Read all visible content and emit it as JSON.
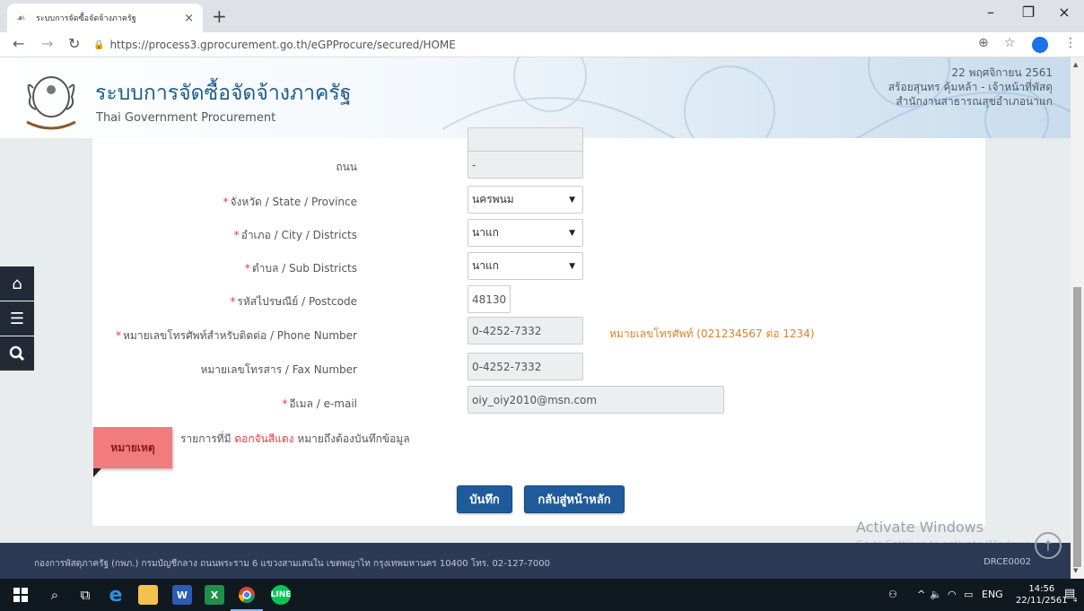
{
  "browser": {
    "tab_title": "ระบบการจัดซื้อจัดจ้างภาครัฐ",
    "tab_close": "×",
    "new_tab": "+",
    "url": "https://process3.gprocurement.go.th/eGPProcure/secured/HOME",
    "window_minimize": "–",
    "window_restore": "❐",
    "window_close": "×"
  },
  "header": {
    "system_title": "ระบบการจัดซื้อจัดจ้างภาครัฐ",
    "system_subtitle": "Thai Government Procurement",
    "date": "22 พฤศจิกายน 2561",
    "user": "สร้อยสุนทร คุ้มหล้า - เจ้าหน้าที่พัสดุ",
    "office": "สำนักงานสาธารณสุขอำเภอนาแก"
  },
  "form": {
    "street_label": "ถนน",
    "street_value": "-",
    "province_label": "จังหวัด / State / Province",
    "province_value": "นครพนม",
    "district_label": "อำเภอ / City / Districts",
    "district_value": "นาแก",
    "subdistrict_label": "ตำบล / Sub Districts",
    "subdistrict_value": "นาแก",
    "postcode_label": "รหัสไปรษณีย์ / Postcode",
    "postcode_value": "48130",
    "phone_label": "หมายเลขโทรศัพท์สำหรับติดต่อ / Phone Number",
    "phone_value": "0-4252-7332",
    "phone_hint": "หมายเลขโทรศัพท์ (021234567 ต่อ 1234)",
    "fax_label": "หมายเลขโทรสาร / Fax Number",
    "fax_value": "0-4252-7332",
    "email_label": "อีเมล / e-mail",
    "email_value": "oiy_oiy2010@msn.com",
    "required_mark": "*"
  },
  "note": {
    "tag": "หมายเหตุ",
    "text_before": "รายการที่มี ",
    "text_red": "ดอกจันสีแดง",
    "text_after": " หมายถึงต้องบันทึกข้อมูล"
  },
  "buttons": {
    "save": "บันทึก",
    "back_home": "กลับสู่หน้าหลัก"
  },
  "watermark": {
    "title": "Activate Windows",
    "subtitle": "Go to Settings to activate Windows."
  },
  "footer": {
    "address": "กองการพัสดุภาครัฐ (กพภ.) กรมบัญชีกลาง ถนนพระราม 6 แขวงสามเสนใน เขตพญาไท กรุงเทพมหานคร 10400 โทร. 02-127-7000",
    "page_code": "DRCE0002"
  },
  "taskbar": {
    "lang": "ENG",
    "time": "14:56",
    "date": "22/11/2561",
    "notification_count": "4"
  },
  "colors": {
    "accent": "#1f5b9a",
    "required": "#e23c3c",
    "hint": "#d9822b",
    "note_tag": "#f27b7e",
    "footer": "#2d3a56"
  }
}
